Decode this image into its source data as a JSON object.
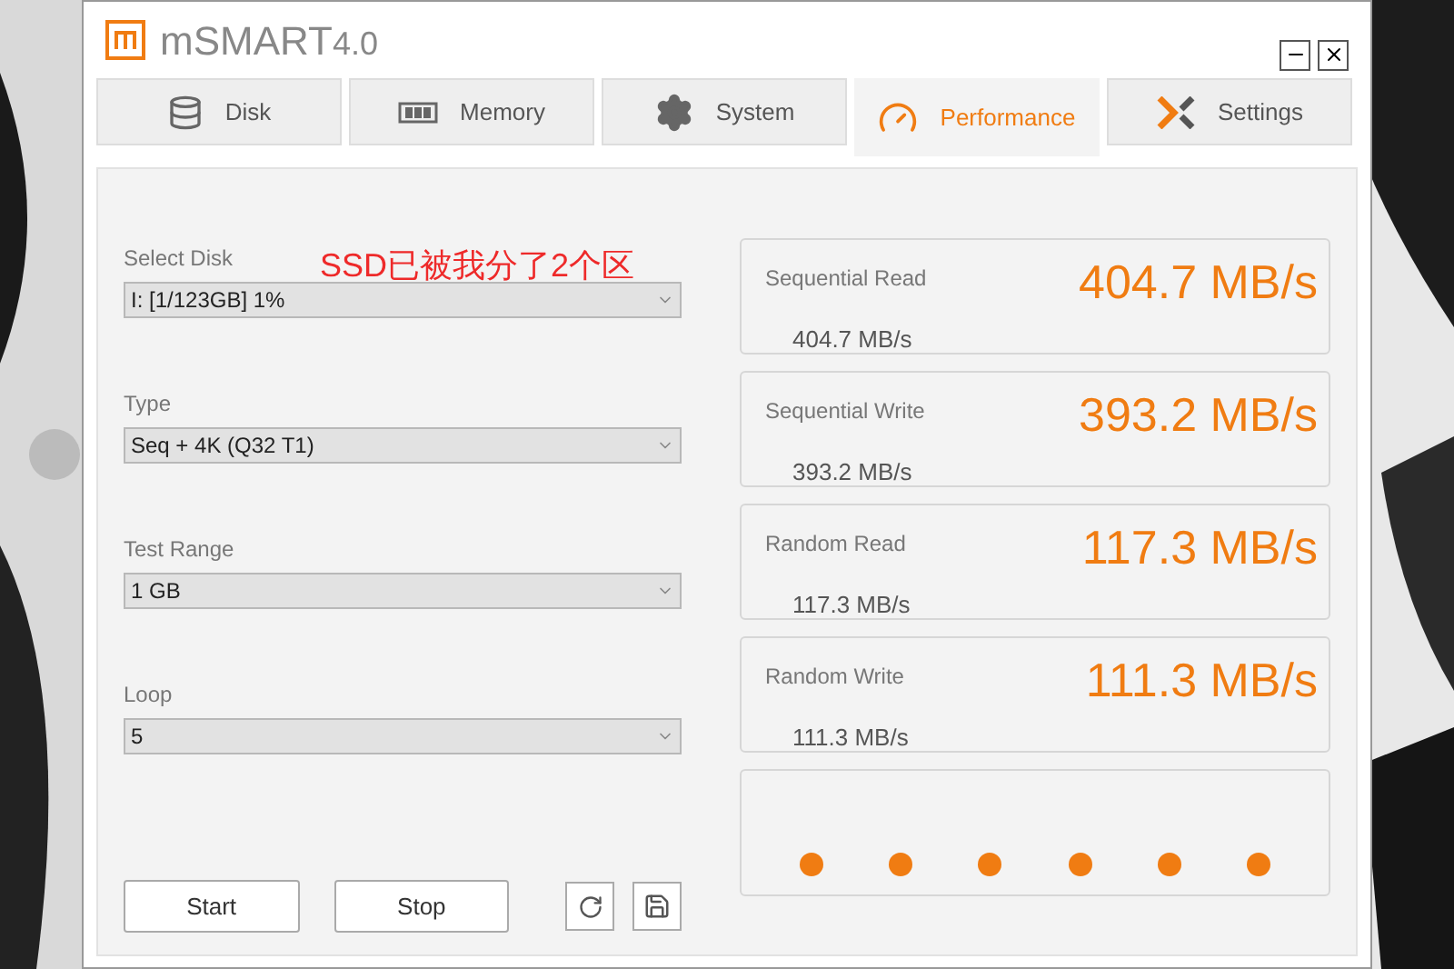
{
  "window": {
    "title": "mSMART",
    "version": "4.0"
  },
  "tabs": [
    {
      "label": "Disk",
      "kind": "disk",
      "selected": false
    },
    {
      "label": "Memory",
      "kind": "memory",
      "selected": false
    },
    {
      "label": "System",
      "kind": "system",
      "selected": false
    },
    {
      "label": "Performance",
      "kind": "performance",
      "selected": true
    },
    {
      "label": "Settings",
      "kind": "settings",
      "selected": false
    }
  ],
  "fields": [
    {
      "label": "Select Disk",
      "value": "I: [1/123GB] 1%"
    },
    {
      "label": "Type",
      "value": "Seq + 4K (Q32 T1)"
    },
    {
      "label": "Test Range",
      "value": "1 GB"
    },
    {
      "label": "Loop",
      "value": "5"
    }
  ],
  "annotation": "SSD已被我分了2个区",
  "buttons": [
    "Start",
    "Stop"
  ],
  "results": [
    {
      "label": "Sequential Read",
      "value": "404.7 MB/s",
      "sub": "404.7 MB/s"
    },
    {
      "label": "Sequential Write",
      "value": "393.2 MB/s",
      "sub": "393.2 MB/s"
    },
    {
      "label": "Random Read",
      "value": "117.3 MB/s",
      "sub": "117.3 MB/s"
    },
    {
      "label": "Random Write",
      "value": "111.3 MB/s",
      "sub": "111.3 MB/s"
    }
  ]
}
